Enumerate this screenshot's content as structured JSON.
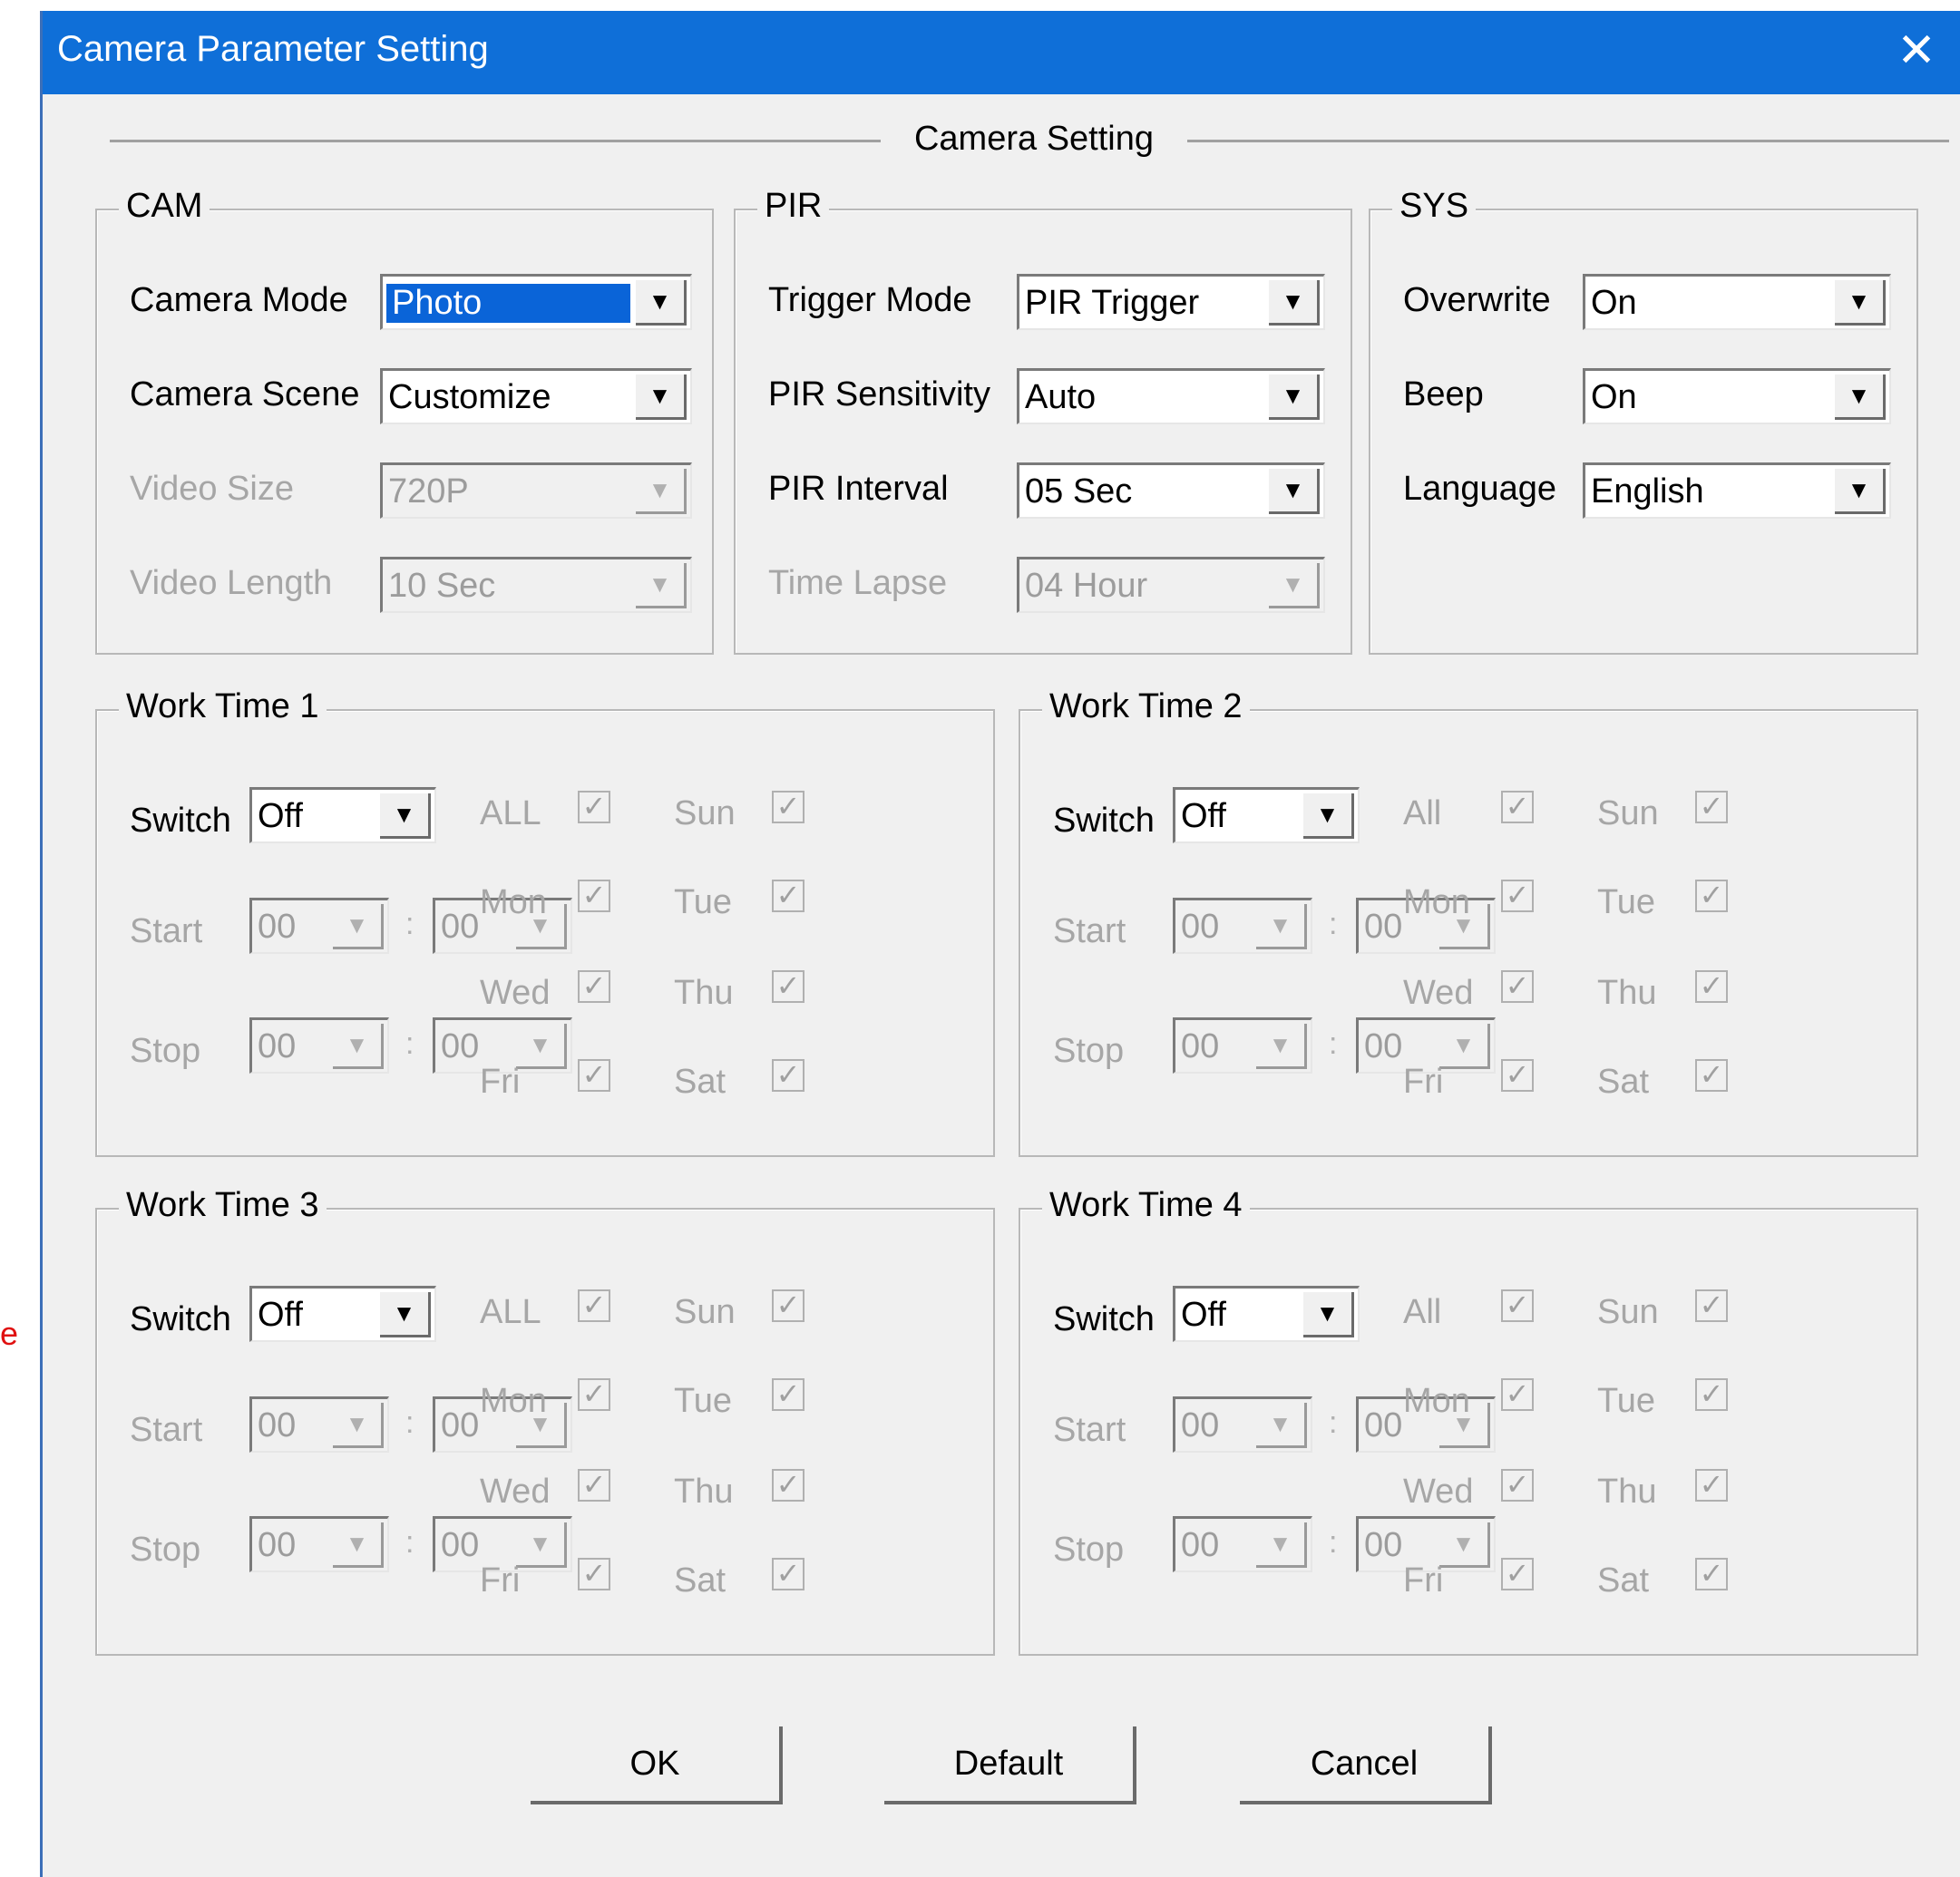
{
  "window": {
    "title": "Camera Parameter Setting",
    "close_glyph": "✕"
  },
  "stray_text": "e",
  "header": {
    "title": "Camera Setting"
  },
  "cam": {
    "legend": "CAM",
    "camera_mode": {
      "label": "Camera Mode",
      "value": "Photo"
    },
    "camera_scene": {
      "label": "Camera Scene",
      "value": "Customize"
    },
    "video_size": {
      "label": "Video Size",
      "value": "720P"
    },
    "video_length": {
      "label": "Video Length",
      "value": "10 Sec"
    }
  },
  "pir": {
    "legend": "PIR",
    "trigger_mode": {
      "label": "Trigger Mode",
      "value": "PIR Trigger"
    },
    "pir_sensitivity": {
      "label": "PIR Sensitivity",
      "value": "Auto"
    },
    "pir_interval": {
      "label": "PIR Interval",
      "value": "05 Sec"
    },
    "time_lapse": {
      "label": "Time Lapse",
      "value": "04 Hour"
    }
  },
  "sys": {
    "legend": "SYS",
    "overwrite": {
      "label": "Overwrite",
      "value": "On"
    },
    "beep": {
      "label": "Beep",
      "value": "On"
    },
    "language": {
      "label": "Language",
      "value": "English"
    }
  },
  "dropdown_glyph": "▼",
  "check_glyph": "✓",
  "time_separator": ":",
  "work_times": [
    {
      "legend": "Work Time 1",
      "switch_label": "Switch",
      "switch_value": "Off",
      "start_label": "Start",
      "stop_label": "Stop",
      "start_hour": "00",
      "start_min": "00",
      "stop_hour": "00",
      "stop_min": "00",
      "days": [
        "ALL",
        "Sun",
        "Mon",
        "Tue",
        "Wed",
        "Thu",
        "Fri",
        "Sat"
      ]
    },
    {
      "legend": "Work Time 2",
      "switch_label": "Switch",
      "switch_value": "Off",
      "start_label": "Start",
      "stop_label": "Stop",
      "start_hour": "00",
      "start_min": "00",
      "stop_hour": "00",
      "stop_min": "00",
      "days": [
        "All",
        "Sun",
        "Mon",
        "Tue",
        "Wed",
        "Thu",
        "Fri",
        "Sat"
      ]
    },
    {
      "legend": "Work Time 3",
      "switch_label": "Switch",
      "switch_value": "Off",
      "start_label": "Start",
      "stop_label": "Stop",
      "start_hour": "00",
      "start_min": "00",
      "stop_hour": "00",
      "stop_min": "00",
      "days": [
        "ALL",
        "Sun",
        "Mon",
        "Tue",
        "Wed",
        "Thu",
        "Fri",
        "Sat"
      ]
    },
    {
      "legend": "Work Time 4",
      "switch_label": "Switch",
      "switch_value": "Off",
      "start_label": "Start",
      "stop_label": "Stop",
      "start_hour": "00",
      "start_min": "00",
      "stop_hour": "00",
      "stop_min": "00",
      "days": [
        "All",
        "Sun",
        "Mon",
        "Tue",
        "Wed",
        "Thu",
        "Fri",
        "Sat"
      ]
    }
  ],
  "buttons": {
    "ok": "OK",
    "default": "Default",
    "cancel": "Cancel"
  }
}
